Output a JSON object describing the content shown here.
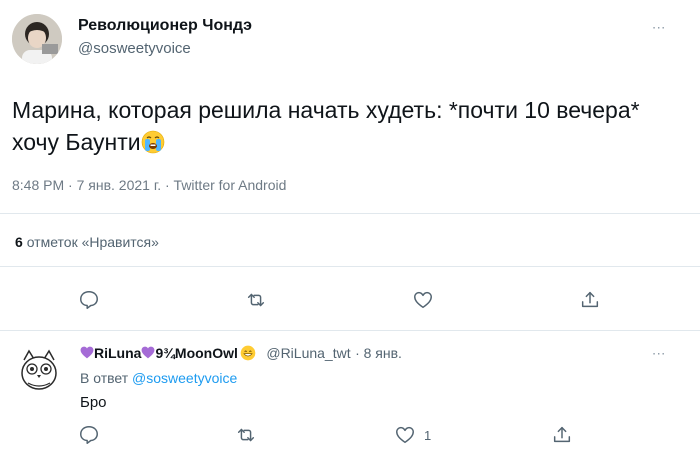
{
  "tweet": {
    "author_name": "Революционер Чондэ",
    "author_handle": "@sosweetyvoice",
    "text": "Марина, которая решила начать худеть: *почти 10 вечера* хочу Баунти",
    "emoji": "crying-face",
    "meta": "8:48 PM · 7 янв. 2021 г. · Twitter for Android",
    "likes_count": "6",
    "likes_label": "отметок «Нравится»",
    "more_label": "ᐧᐧᐧ"
  },
  "reply": {
    "name_part1": "RiLuna",
    "name_part2": "9¾MoonOwl",
    "handle": "@RiLuna_twt",
    "time": "· 8 янв.",
    "reply_to_label": "В ответ",
    "reply_to_handle": "@sosweetyvoice",
    "text": "Бро",
    "like_count": "1",
    "more_label": "ᐧᐧᐧ"
  },
  "colors": {
    "accent": "#1d9bf0",
    "purple_heart": "#a56bd6",
    "divider": "#e1e8ed"
  }
}
